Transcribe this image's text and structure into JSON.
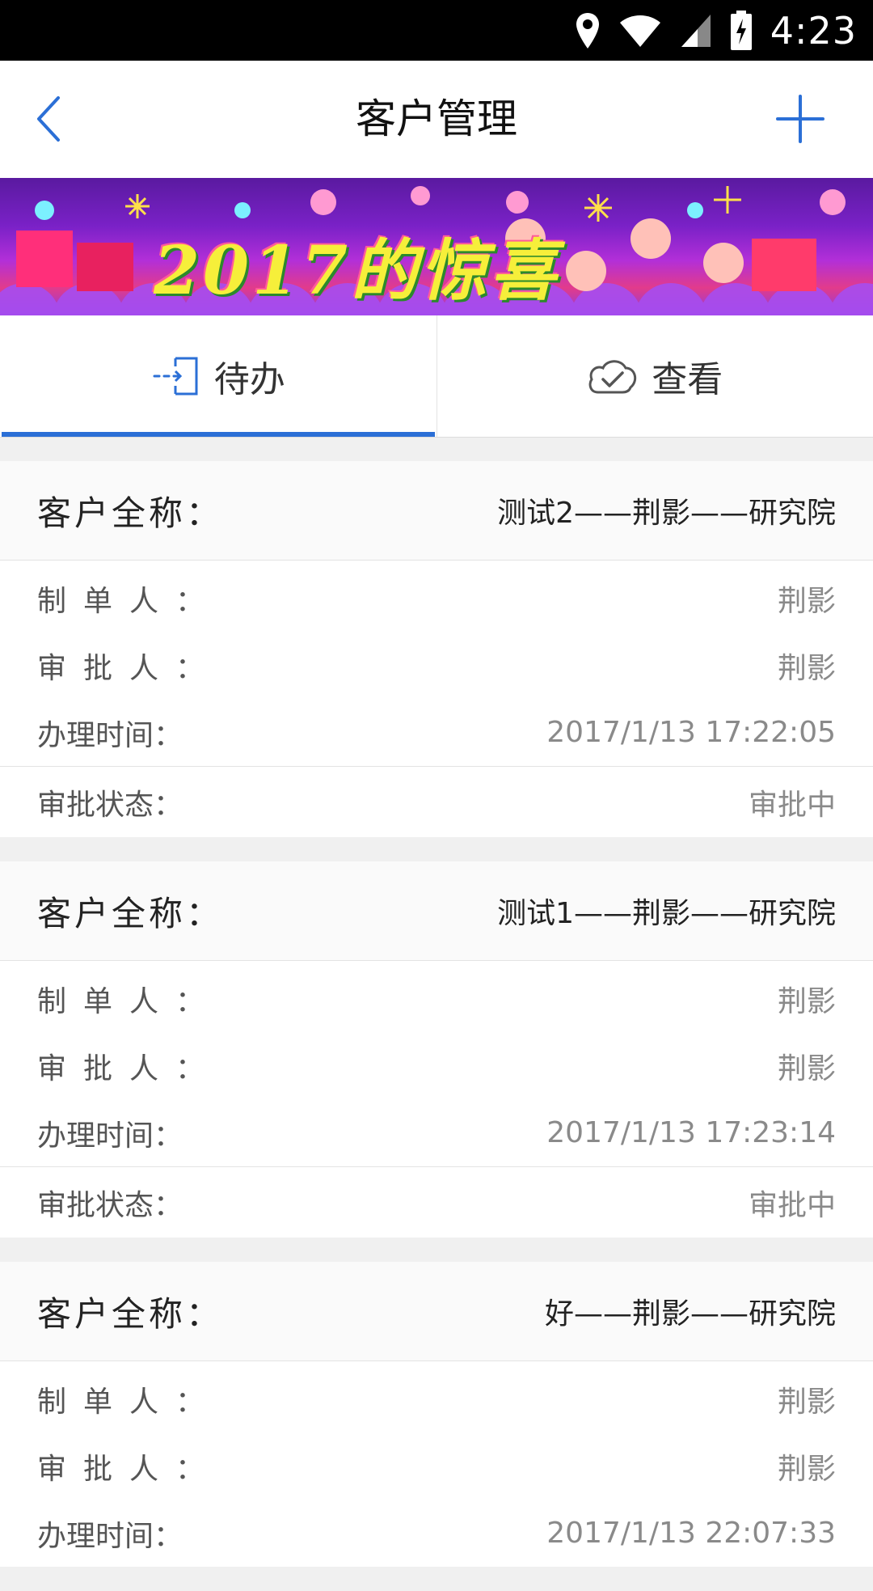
{
  "status_bar": {
    "time": "4:23"
  },
  "header": {
    "title": "客户管理"
  },
  "banner": {
    "text": "2017的惊喜"
  },
  "tabs": [
    {
      "label": "待办",
      "icon": "enter-door-icon",
      "active": true
    },
    {
      "label": "查看",
      "icon": "check-cloud-icon",
      "active": false
    }
  ],
  "labels": {
    "customer_name": "客户全称：",
    "creator": "制单人：",
    "approver": "审批人：",
    "handle_time": "办理时间：",
    "approval_status": "审批状态："
  },
  "records": [
    {
      "customer_name": "测试2——荆影——研究院",
      "creator": "荆影",
      "approver": "荆影",
      "handle_time": "2017/1/13 17:22:05",
      "approval_status": "审批中"
    },
    {
      "customer_name": "测试1——荆影——研究院",
      "creator": "荆影",
      "approver": "荆影",
      "handle_time": "2017/1/13 17:23:14",
      "approval_status": "审批中"
    },
    {
      "customer_name": "好——荆影——研究院",
      "creator": "荆影",
      "approver": "荆影",
      "handle_time": "2017/1/13 22:07:33"
    }
  ],
  "colors": {
    "accent": "#2b6fd6",
    "status_bar": "#000000"
  }
}
